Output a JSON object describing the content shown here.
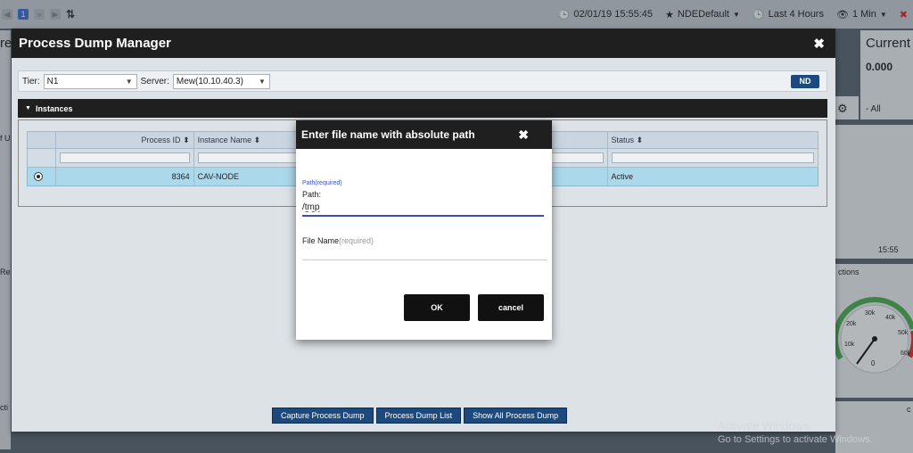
{
  "topbar": {
    "datetime": "02/01/19 15:55:45",
    "profile": "NDEDefault",
    "time_range": "Last 4 Hours",
    "interval": "1 Min",
    "page_number": "1"
  },
  "background": {
    "current_title": "Current",
    "current_value": "0.000",
    "all_label": "- All",
    "time_tick": "15:55",
    "ctions_label": "ctions",
    "left_edge_1": "re",
    "left_edge_2": "f U",
    "left_edge_3": "Re",
    "left_edge_4": "cti",
    "right_edge_c": "c",
    "gauge_labels": [
      "10k",
      "20k",
      "30k",
      "40k",
      "50k",
      "60k",
      "0"
    ]
  },
  "dialog": {
    "title": "Process Dump Manager",
    "tier_label": "Tier:",
    "tier_value": "N1",
    "server_label": "Server:",
    "server_value": "Mew(10.10.40.3)",
    "nd_button": "ND",
    "instances_label": "Instances",
    "columns": [
      "Process ID",
      "Instance Name",
      "Status"
    ],
    "rows": [
      {
        "process_id": "8364",
        "instance_name": "CAV-NODE",
        "status": "Active"
      }
    ],
    "buttons": [
      "Capture Process Dump",
      "Process Dump List",
      "Show All Process Dump"
    ]
  },
  "file_dialog": {
    "title": "Enter file name with absolute path",
    "path_required": "Path(required)",
    "path_label": "Path:",
    "path_value": "/tmp",
    "filename_label": "File Name",
    "filename_required": "(required)",
    "ok": "OK",
    "cancel": "cancel"
  },
  "watermark": {
    "line1": "Activate Windows",
    "line2": "Go to Settings to activate Windows."
  }
}
